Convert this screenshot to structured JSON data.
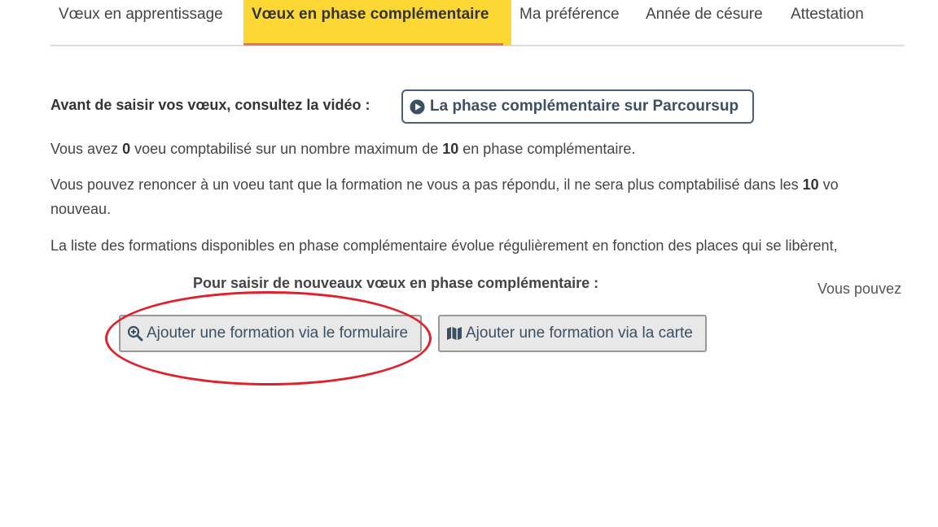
{
  "tabs": [
    {
      "label": "Vœux en apprentissage",
      "active": false
    },
    {
      "label": "Vœux en phase complémentaire",
      "active": true
    },
    {
      "label": "Ma préférence",
      "active": false
    },
    {
      "label": "Année de césure",
      "active": false
    },
    {
      "label": "Attestation",
      "active": false
    }
  ],
  "video": {
    "intro": "Avant de saisir vos vœux, consultez la vidéo :",
    "button_label": "La phase complémentaire sur Parcoursup",
    "icon": "play-circle-icon"
  },
  "count_line": {
    "prefix": "Vous avez ",
    "count": "0",
    "middle": " voeu comptabilisé sur un nombre maximum de ",
    "max": "10",
    "suffix": " en phase complémentaire."
  },
  "renounce_line": {
    "prefix": "Vous pouvez renoncer à un voeu tant que la formation ne vous a pas répondu, il ne sera plus comptabilisé dans les ",
    "max": "10",
    "suffix": " vo",
    "continuation": "nouveau."
  },
  "list_line": "La liste des formations disponibles en phase complémentaire évolue régulièrement en fonction des places qui se libèrent,",
  "new_wishes": {
    "title": "Pour saisir de nouveaux vœux en phase complémentaire :",
    "right_text": "Vous pouvez",
    "form_button": {
      "label": "Ajouter une formation via le formulaire",
      "icon": "search-plus-icon"
    },
    "map_button": {
      "label": "Ajouter une formation via la carte",
      "icon": "map-icon"
    }
  },
  "colors": {
    "active_tab": "#fdd835",
    "active_tab_underline": "#e57373",
    "button_text": "#3d4f63",
    "annotation": "#e0202a"
  }
}
